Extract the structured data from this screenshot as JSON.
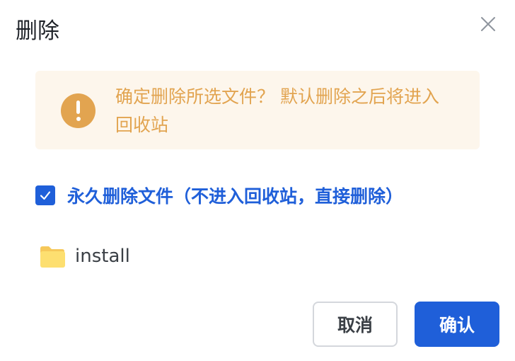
{
  "dialog": {
    "title": "删除",
    "close_icon": "close-icon"
  },
  "warning": {
    "icon": "exclamation-circle-icon",
    "color": "#e2a450",
    "background": "#fdf6ec",
    "text": "确定删除所选文件？ 默认删除之后将进入回收站"
  },
  "option": {
    "checked": true,
    "label": "永久删除文件（不进入回收站，直接删除）",
    "color": "#1f5fd9"
  },
  "file": {
    "icon": "folder-icon",
    "name": "install"
  },
  "buttons": {
    "cancel_label": "取消",
    "confirm_label": "确认"
  }
}
